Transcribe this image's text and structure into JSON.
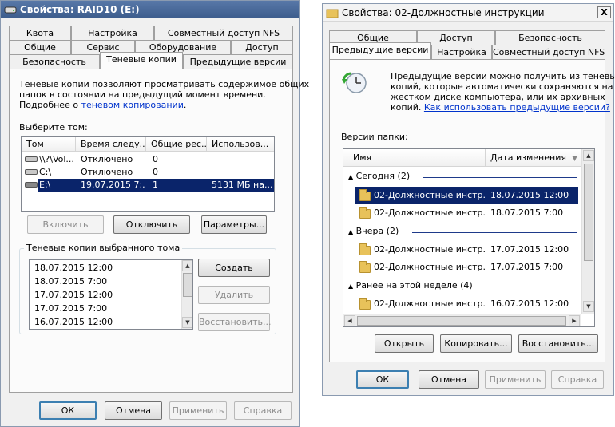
{
  "left_dialog": {
    "title": "Свойства: RAID10 (E:)",
    "tabs_row1": [
      "Квота",
      "Настройка",
      "Совместный доступ NFS"
    ],
    "tabs_row2": [
      "Общие",
      "Сервис",
      "Оборудование",
      "Доступ"
    ],
    "tabs_row3": [
      "Безопасность",
      "Теневые копии",
      "Предыдущие версии"
    ],
    "active_tab": "Теневые копии",
    "description_line1": "Теневые копии позволяют просматривать содержимое общих",
    "description_line2": "папок в состоянии на предыдущий момент времени.",
    "description_line3_prefix": "Подробнее о",
    "description_link": "теневом копировании",
    "description_line3_suffix": ".",
    "select_volume_label": "Выберите том:",
    "volume_columns": [
      "Том",
      "Время следу...",
      "Общие рес...",
      "Использов..."
    ],
    "volumes": [
      {
        "volume": "\\\\?\\Vol...",
        "next_run": "Отключено",
        "shares": "0",
        "used": ""
      },
      {
        "volume": "C:\\",
        "next_run": "Отключено",
        "shares": "0",
        "used": ""
      },
      {
        "volume": "E:\\",
        "next_run": "19.07.2015 7:...",
        "shares": "1",
        "used": "5131 МБ на..."
      }
    ],
    "selected_volume_index": 2,
    "buttons": {
      "enable": "Включить",
      "disable": "Отключить",
      "settings": "Параметры..."
    },
    "shadow_group_label": "Теневые копии выбранного тома",
    "shadow_copies": [
      "18.07.2015 12:00",
      "18.07.2015 7:00",
      "17.07.2015 12:00",
      "17.07.2015 7:00",
      "16.07.2015 12:00"
    ],
    "shadow_buttons": {
      "create": "Создать",
      "delete": "Удалить",
      "restore": "Восстановить..."
    },
    "footer": {
      "ok": "ОК",
      "cancel": "Отмена",
      "apply": "Применить",
      "help": "Справка"
    }
  },
  "right_dialog": {
    "title": "Свойства: 02-Должностные инструкции",
    "close_symbol": "X",
    "tabs_row1": [
      "Общие",
      "Доступ",
      "Безопасность"
    ],
    "tabs_row2": [
      "Предыдущие версии",
      "Настройка",
      "Совместный доступ NFS"
    ],
    "active_tab": "Предыдущие версии",
    "info_line1": "Предыдущие версии можно получить из теневых",
    "info_line2": "копий, которые автоматически сохраняются на",
    "info_line3": "жестком диске компьютера, или их архивных",
    "info_line4_prefix": "копий.",
    "info_link": "Как использовать предыдущие версии?",
    "folder_versions_label": "Версии папки:",
    "columns": [
      "Имя",
      "Дата изменения"
    ],
    "groups": [
      {
        "label": "Сегодня (2)",
        "items": [
          {
            "name": "02-Должностные инстр...",
            "date": "18.07.2015 12:00"
          },
          {
            "name": "02-Должностные инстр...",
            "date": "18.07.2015 7:00"
          }
        ]
      },
      {
        "label": "Вчера (2)",
        "items": [
          {
            "name": "02-Должностные инстр...",
            "date": "17.07.2015 12:00"
          },
          {
            "name": "02-Должностные инстр...",
            "date": "17.07.2015 7:00"
          }
        ]
      },
      {
        "label": "Ранее на этой неделе (4)",
        "items": [
          {
            "name": "02-Должностные инстр...",
            "date": "16.07.2015 12:00"
          }
        ]
      }
    ],
    "buttons": {
      "open": "Открыть",
      "copy": "Копировать...",
      "restore": "Восстановить..."
    },
    "footer": {
      "ok": "ОК",
      "cancel": "Отмена",
      "apply": "Применить",
      "help": "Справка"
    }
  },
  "colors": {
    "selection": "#0a246a",
    "link": "#0033cc",
    "right_selection": "#0a246a"
  },
  "icons": [
    "drive-icon",
    "folder-icon",
    "clock-restore-icon",
    "sort-down-icon"
  ]
}
